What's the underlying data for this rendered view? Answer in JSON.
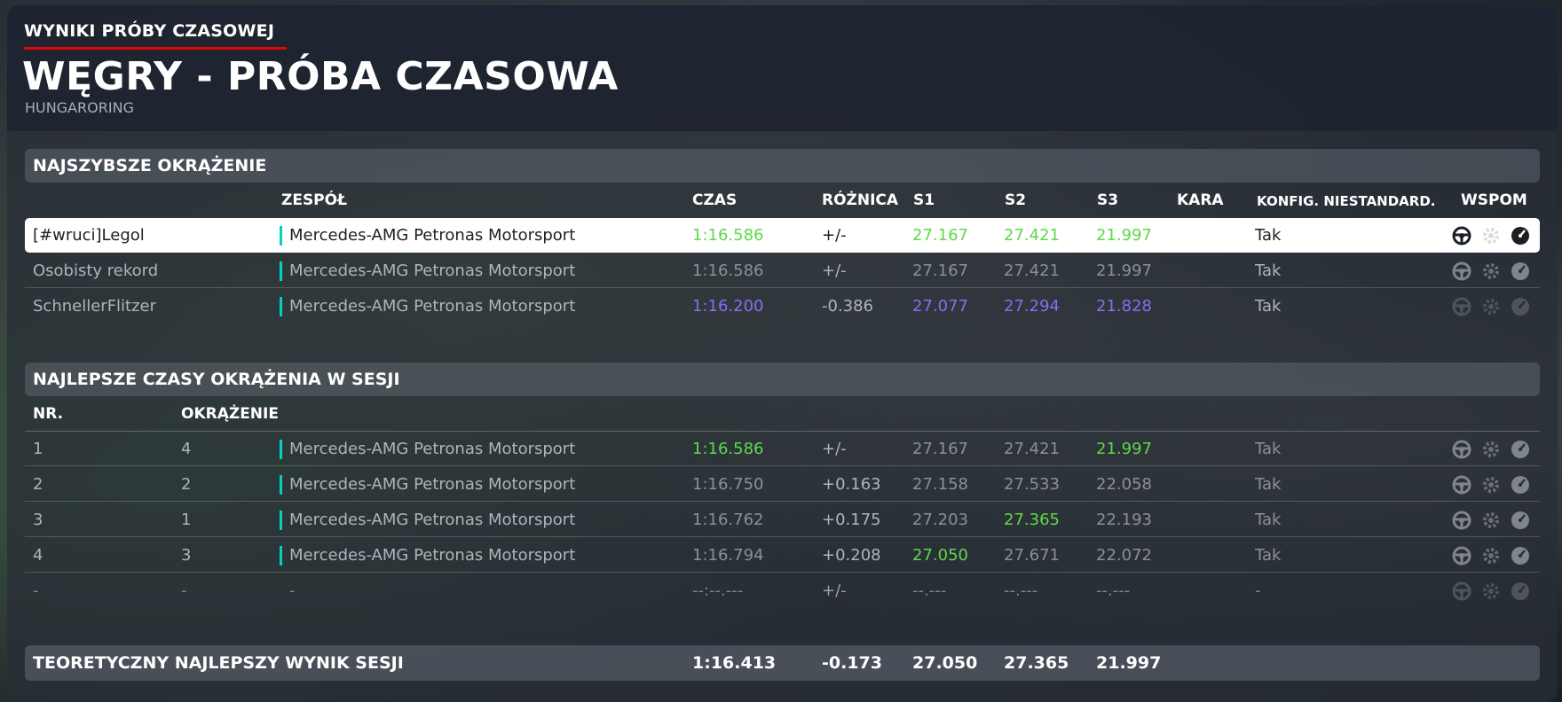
{
  "header": {
    "subtitle": "WYNIKI PRÓBY CZASOWEJ",
    "title": "WĘGRY - PRÓBA CZASOWA",
    "track": "HUNGARORING"
  },
  "fastest": {
    "section_title": "NAJSZYBSZE OKRĄŻENIE",
    "columns": {
      "team": "ZESPÓŁ",
      "time": "CZAS",
      "diff": "RÓŻNICA",
      "s1": "S1",
      "s2": "S2",
      "s3": "S3",
      "penalty": "KARA",
      "config": "KONFIG. NIESTANDARD.",
      "assists": "WSPOM"
    },
    "rows": [
      {
        "name": "[#wruci]Legol",
        "team": "Mercedes-AMG Petronas Motorsport",
        "time": "1:16.586",
        "diff": "+/-",
        "s1": "27.167",
        "s2": "27.421",
        "s3": "21.997",
        "config": "Tak"
      },
      {
        "name": "Osobisty rekord",
        "team": "Mercedes-AMG Petronas Motorsport",
        "time": "1:16.586",
        "diff": "+/-",
        "s1": "27.167",
        "s2": "27.421",
        "s3": "21.997",
        "config": "Tak"
      },
      {
        "name": "SchnellerFlitzer",
        "team": "Mercedes-AMG Petronas Motorsport",
        "time": "1:16.200",
        "diff": "-0.386",
        "s1": "27.077",
        "s2": "27.294",
        "s3": "21.828",
        "config": "Tak"
      }
    ]
  },
  "session": {
    "section_title": "NAJLEPSZE CZASY OKRĄŻENIA W SESJI",
    "columns": {
      "nr": "NR.",
      "lap": "OKRĄŻENIE"
    },
    "rows": [
      {
        "nr": "1",
        "lap": "4",
        "team": "Mercedes-AMG Petronas Motorsport",
        "time": "1:16.586",
        "diff": "+/-",
        "s1": "27.167",
        "s2": "27.421",
        "s3": "21.997",
        "config": "Tak"
      },
      {
        "nr": "2",
        "lap": "2",
        "team": "Mercedes-AMG Petronas Motorsport",
        "time": "1:16.750",
        "diff": "+0.163",
        "s1": "27.158",
        "s2": "27.533",
        "s3": "22.058",
        "config": "Tak"
      },
      {
        "nr": "3",
        "lap": "1",
        "team": "Mercedes-AMG Petronas Motorsport",
        "time": "1:16.762",
        "diff": "+0.175",
        "s1": "27.203",
        "s2": "27.365",
        "s3": "22.193",
        "config": "Tak"
      },
      {
        "nr": "4",
        "lap": "3",
        "team": "Mercedes-AMG Petronas Motorsport",
        "time": "1:16.794",
        "diff": "+0.208",
        "s1": "27.050",
        "s2": "27.671",
        "s3": "22.072",
        "config": "Tak"
      },
      {
        "nr": "-",
        "lap": "-",
        "team": "-",
        "time": "--:--.---",
        "diff": "+/-",
        "s1": "--.---",
        "s2": "--.---",
        "s3": "--.---",
        "config": "-"
      }
    ]
  },
  "summary": {
    "label": "TEORETYCZNY NAJLEPSZY WYNIK SESJI",
    "time": "1:16.413",
    "diff": "-0.173",
    "s1": "27.050",
    "s2": "27.365",
    "s3": "21.997"
  },
  "colors": {
    "best_green": "#5fd84a",
    "overall_purple": "#8a6cf0",
    "team_accent": "#00d2be",
    "highlight_red": "#e10600"
  },
  "icons": [
    "steering-wheel-icon",
    "gear-icon",
    "tachometer-icon"
  ]
}
